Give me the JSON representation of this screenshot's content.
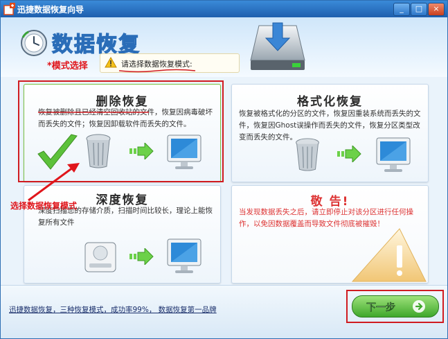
{
  "window": {
    "title": "迅捷数据恢复向导",
    "controls": [
      "_",
      "□",
      "×"
    ]
  },
  "header": {
    "title": "数据恢复",
    "mode_label": "*模式选择",
    "prompt": "请选择数据恢复模式:"
  },
  "cards": {
    "delete": {
      "title": "删除恢复",
      "desc": "恢复被删除且已经清空回收站的文件，恢复因病毒破坏而丢失的文件；恢复因卸载软件而丢失的文件。"
    },
    "format": {
      "title": "格式化恢复",
      "desc": "恢复被格式化的分区的文件，恢复因重装系统而丢失的文件，恢复因Ghost误操作而丢失的文件，恢复分区类型改变而丢失的文件。"
    },
    "deep": {
      "title": "深度恢复",
      "desc": "深度扫描您的存储介质，扫描时间比较长，理论上能恢复所有文件"
    },
    "warning": {
      "title": "敬 告!",
      "desc": "当发现数据丢失之后，请立即停止对该分区进行任何操作，以免因数据覆盖而导致文件彻底被摧毁！"
    }
  },
  "annotation": {
    "label": "选择数据恢复模式"
  },
  "footer": {
    "link": "迅捷数据恢复，三种恢复模式，成功率99%， 数据恢复第一品牌"
  },
  "next_button": {
    "label": "下一步"
  },
  "colors": {
    "accent_red": "#d01b20",
    "primary_blue": "#2a6db8",
    "next_green": "#3fa72b"
  }
}
